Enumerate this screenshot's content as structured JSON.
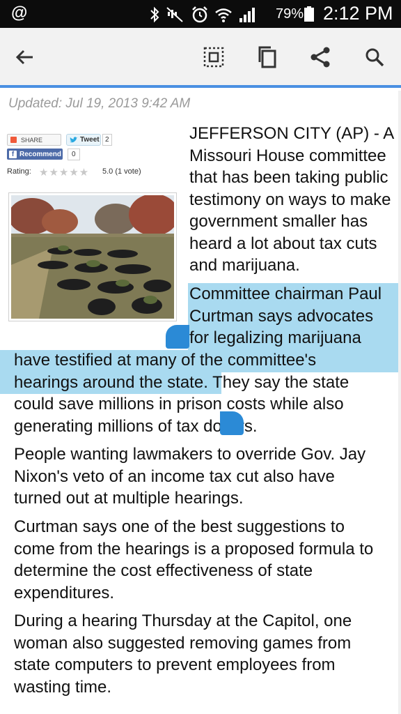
{
  "status_bar": {
    "app_icon": "at-sign",
    "icons": [
      "bluetooth-icon",
      "mute-icon",
      "alarm-icon",
      "wifi-icon",
      "signal-icon"
    ],
    "battery_percent": "79%",
    "time": "2:12 PM"
  },
  "toolbar": {
    "back_icon": "back-arrow-icon",
    "actions": [
      "select-all-icon",
      "copy-icon",
      "share-icon",
      "search-icon"
    ],
    "accent_color": "#4a90e2"
  },
  "article": {
    "updated": "Updated: Jul 19, 2013 9:42 AM",
    "widget": {
      "share_label": "SHARE",
      "tweet_label": "Tweet",
      "tweet_count": "2",
      "recommend_label": "Recommend",
      "recommend_count": "0",
      "rating_label": "Rating:",
      "rating_value": "5.0 (1 vote)"
    },
    "right_lines": [
      "JEFFERSON CITY (AP) - A",
      "Missouri House committee",
      "that has been taking public",
      "testimony on ways to make",
      "government smaller has",
      "heard a lot about tax cuts",
      "and marijuana."
    ],
    "selected_right_lines": [
      "Committee chairman Paul",
      "Curtman says advocates",
      "for legalizing marijuana"
    ],
    "selected_full_lines": [
      "have testified at many of the committee's",
      "hearings around the state"
    ],
    "para2_rest_first": ". They say the state",
    "para2_more": [
      "could save millions in prison costs while also",
      "generating millions of tax dollars."
    ],
    "para3": [
      "People wanting lawmakers to override Gov. Jay",
      "Nixon's veto of an income tax cut also have",
      "turned out at multiple hearings."
    ],
    "para4": [
      "Curtman says one of the best suggestions to",
      "come from the hearings is a proposed formula to",
      "determine the cost effectiveness of state",
      "expenditures."
    ],
    "para5": [
      "During a hearing Thursday at the Capitol, one",
      "woman also suggested removing games from",
      "state computers to prevent employees from",
      "wasting time."
    ]
  },
  "selection_color": "#a9daf0",
  "handle_color": "#2b8ad6"
}
